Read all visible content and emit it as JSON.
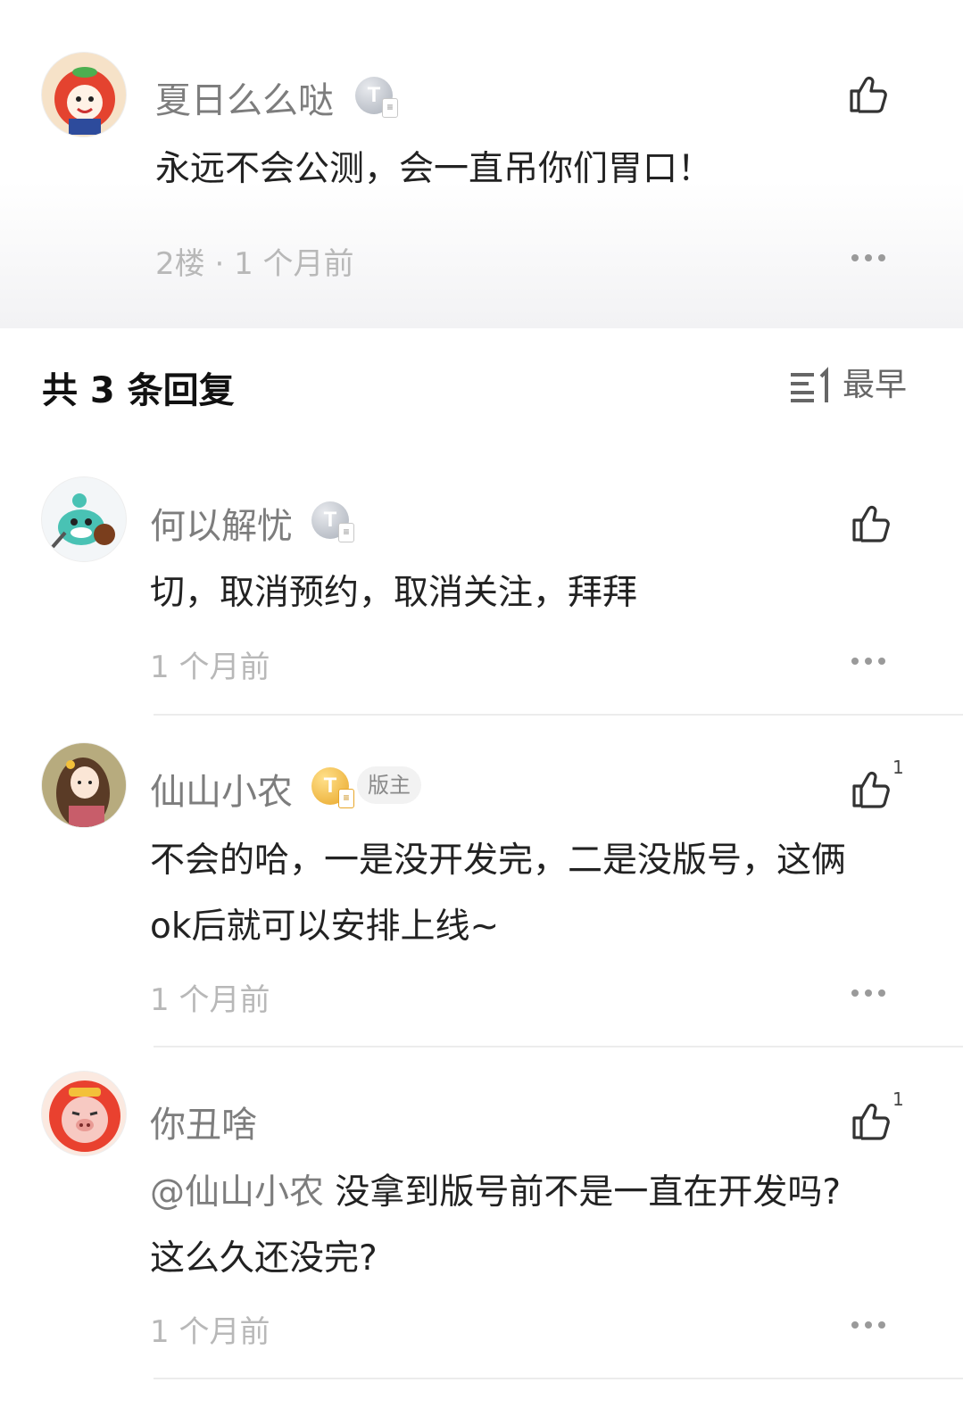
{
  "parent_comment": {
    "username": "夏日么么哒",
    "level_badge": "T",
    "text": "永远不会公测，会一直吊你们胃口！",
    "floor": "2楼",
    "separator": "·",
    "time": "1 个月前"
  },
  "replies_header": {
    "title": "共 3 条回复",
    "sort_label": "最早"
  },
  "replies": [
    {
      "username": "何以解忧",
      "level_badge": "T",
      "text_lines": [
        "切，取消预约，取消关注，拜拜"
      ],
      "time": "1 个月前",
      "like_count": ""
    },
    {
      "username": "仙山小农",
      "level_badge": "T",
      "role_tag": "版主",
      "text_lines": [
        "不会的哈，一是没开发完，二是没版号，这俩",
        "ok后就可以安排上线~"
      ],
      "time": "1 个月前",
      "like_count": "1"
    },
    {
      "username": "你丑啥",
      "mention": "@仙山小农",
      "text_lines": [
        "没拿到版号前不是一直在开发吗?",
        "这么久还没完?"
      ],
      "time": "1 个月前",
      "like_count": "1"
    }
  ],
  "colors": {
    "username": "#7d7d7d",
    "meta": "#b8b8b8",
    "text": "#222222",
    "gold_badge": "#e8a628",
    "silver_badge": "#a9afb9"
  }
}
